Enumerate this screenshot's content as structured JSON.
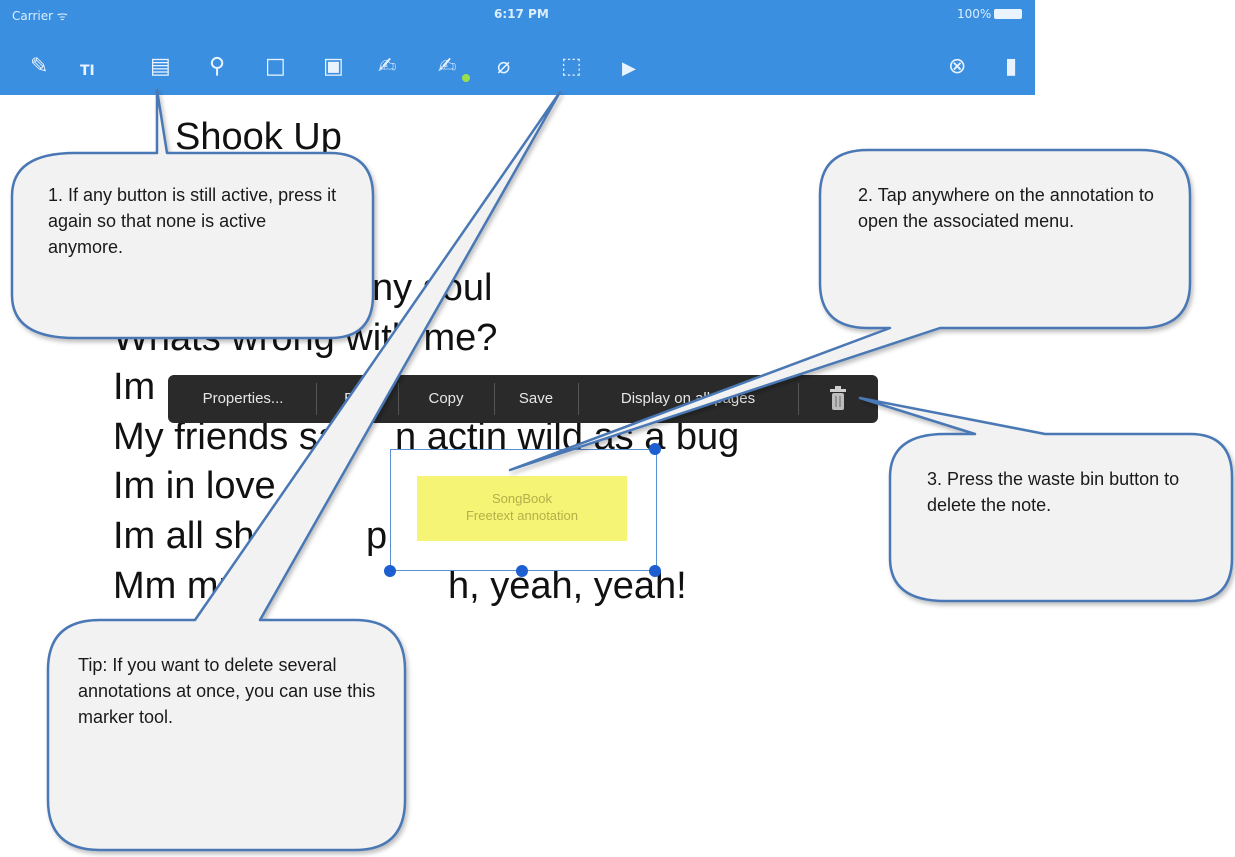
{
  "status_bar": {
    "carrier": "Carrier ᯤ",
    "time": "6:17 PM",
    "battery": "100%"
  },
  "toolbar": {
    "tools": [
      {
        "icon": "pen-icon",
        "glyph": "✎"
      },
      {
        "icon": "text-tool-icon",
        "glyph": "TI"
      },
      {
        "icon": "note-icon",
        "glyph": "▤"
      },
      {
        "icon": "stamp-icon",
        "glyph": "⚲"
      },
      {
        "icon": "rectangle-icon",
        "glyph": "□"
      },
      {
        "icon": "image-icon",
        "glyph": "▣"
      },
      {
        "icon": "freehand-icon",
        "glyph": "✍"
      },
      {
        "icon": "highlighter-icon",
        "glyph": "✍"
      },
      {
        "icon": "eraser-icon",
        "glyph": "⌀"
      },
      {
        "icon": "marker-select-icon",
        "glyph": "⬚"
      },
      {
        "icon": "play-icon",
        "glyph": "▶"
      }
    ],
    "right": [
      {
        "icon": "close-icon",
        "glyph": "⊗"
      },
      {
        "icon": "bookmark-icon",
        "glyph": "▮"
      }
    ]
  },
  "song": {
    "title": "Shook Up",
    "lines": [
      "ny soul",
      "Whats wrong with me?",
      "Im",
      "My friends sa",
      "n actin wild as a bug",
      "Im in love",
      "Im all sho",
      "p",
      "Mm mm",
      "h, yeah, yeah!"
    ]
  },
  "context_menu": {
    "items": [
      "Properties...",
      "Edit",
      "Copy",
      "Save",
      "Display on all pages"
    ],
    "delete_icon": "trash-icon"
  },
  "annotation": {
    "line1": "SongBook",
    "line2": "Freetext annotation"
  },
  "callouts": {
    "c1": "1. If any button is still active, press it again so that none is active anymore.",
    "c2": "2. Tap anywhere on the annotation to open the associated menu.",
    "c3": "3. Press the waste bin button to delete the note.",
    "tip": "Tip: If you want to delete several annotations at once, you can use this marker tool."
  },
  "colors": {
    "toolbar": "#3b8fe0",
    "callout_fill": "#f2f2f2",
    "callout_stroke": "#4a78b5",
    "annotation_fill": "#f6f474",
    "menu_bg": "#2a2a2a"
  }
}
